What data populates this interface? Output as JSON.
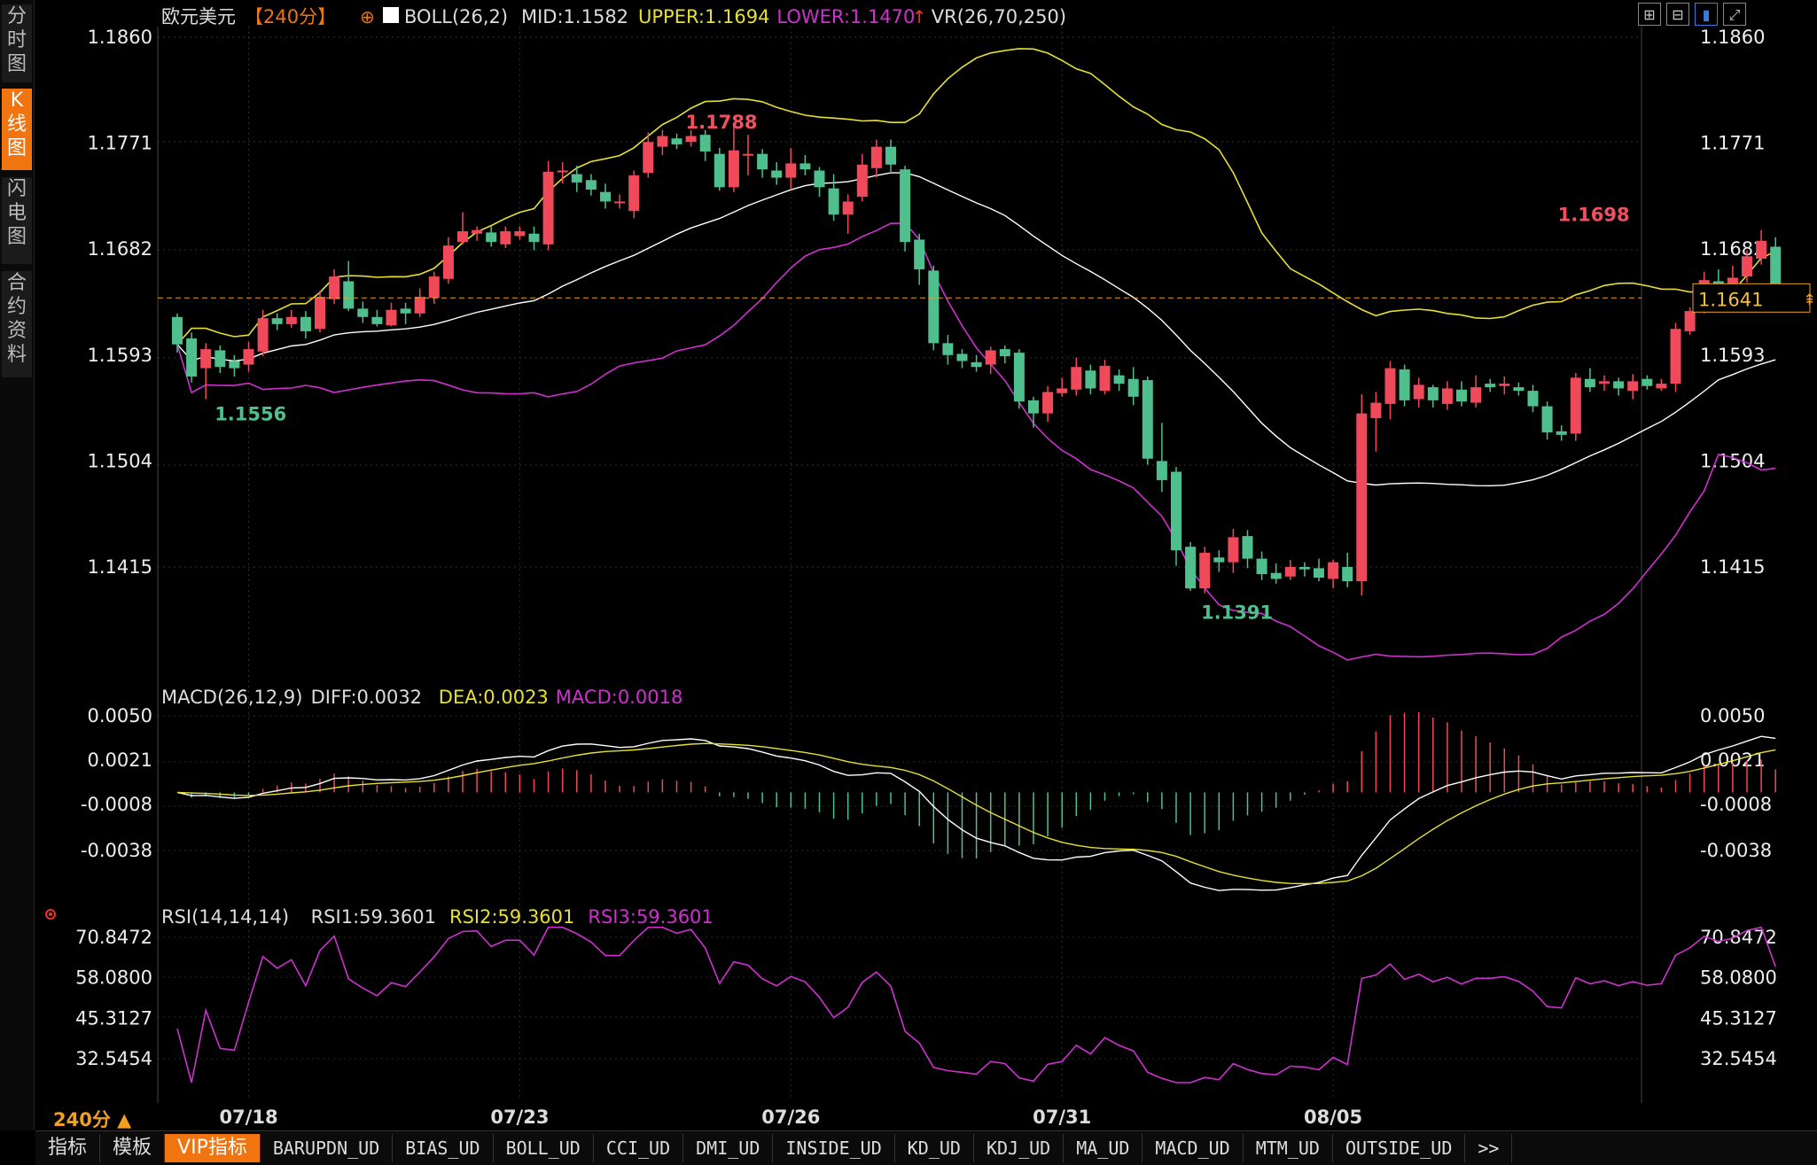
{
  "sidebar": {
    "tabs": [
      "分时图",
      "K线图",
      "闪电图",
      "合约资料"
    ],
    "active": 1
  },
  "toolbar_icons": [
    "layout-icon",
    "grid-icon",
    "chart-icon",
    "expand-icon"
  ],
  "header": {
    "symbol": "欧元美元",
    "period_tag": "【240分】",
    "boll": "BOLL(26,2)",
    "mid": "MID:1.1582",
    "upper": "UPPER:1.1694",
    "lower": "LOWER:1.1470",
    "vr": "VR(26,70,250)"
  },
  "macd_header": {
    "name": "MACD(26,12,9)",
    "diff": "DIFF:0.0032",
    "dea": "DEA:0.0023",
    "macd": "MACD:0.0018"
  },
  "rsi_header": {
    "name": "RSI(14,14,14)",
    "rsi1": "RSI1:59.3601",
    "rsi2": "RSI2:59.3601",
    "rsi3": "RSI3:59.3601"
  },
  "period_label": "240分 ▲",
  "bottom_tabs": [
    "指标",
    "模板",
    "VIP指标",
    "BARUPDN_UD",
    "BIAS_UD",
    "BOLL_UD",
    "CCI_UD",
    "DMI_UD",
    "INSIDE_UD",
    "KD_UD",
    "KDJ_UD",
    "MA_UD",
    "MACD_UD",
    "MTM_UD",
    "OUTSIDE_UD",
    ">>"
  ],
  "bottom_active": 2,
  "colors": {
    "up": "#f04a5a",
    "down": "#4fc08d",
    "upper": "#e8e030",
    "mid": "#ffffff",
    "lower": "#d030d0",
    "accent": "#f0740f",
    "label_high": "#f05060",
    "label_low": "#4fc08d"
  },
  "chart_data": {
    "type": "candlestick",
    "price_axis": {
      "ticks": [
        1.186,
        1.1771,
        1.1682,
        1.1593,
        1.1504,
        1.1415
      ],
      "range": [
        1.1325,
        1.1885
      ],
      "last_price": 1.1641
    },
    "dates": [
      "07/18",
      "07/23",
      "07/26",
      "07/31",
      "08/05"
    ],
    "date_index": [
      5,
      24,
      43,
      62,
      81
    ],
    "annotations": {
      "high": {
        "value": "1.1788",
        "index": 35
      },
      "low": {
        "value": "1.1391",
        "index": 71
      },
      "local_low": {
        "value": "1.1556",
        "index": 2
      },
      "local_high": {
        "value": "1.1698",
        "index": 96
      }
    },
    "candles": [
      [
        1.1625,
        1.1602,
        1.1628,
        1.1595
      ],
      [
        1.1607,
        1.1575,
        1.1612,
        1.157
      ],
      [
        1.1582,
        1.1598,
        1.1603,
        1.1556
      ],
      [
        1.1597,
        1.1583,
        1.1601,
        1.1578
      ],
      [
        1.1588,
        1.1582,
        1.1593,
        1.1575
      ],
      [
        1.1585,
        1.1598,
        1.1604,
        1.1579
      ],
      [
        1.1596,
        1.1624,
        1.1631,
        1.1592
      ],
      [
        1.1624,
        1.1619,
        1.1628,
        1.1614
      ],
      [
        1.1619,
        1.1625,
        1.1631,
        1.1616
      ],
      [
        1.1625,
        1.1613,
        1.163,
        1.1607
      ],
      [
        1.1615,
        1.1642,
        1.1647,
        1.1612
      ],
      [
        1.164,
        1.1659,
        1.1665,
        1.1636
      ],
      [
        1.1655,
        1.1632,
        1.1672,
        1.163
      ],
      [
        1.1632,
        1.1625,
        1.1638,
        1.162
      ],
      [
        1.1625,
        1.1619,
        1.1631,
        1.1617
      ],
      [
        1.1618,
        1.1631,
        1.1637,
        1.1617
      ],
      [
        1.1632,
        1.1628,
        1.1637,
        1.1619
      ],
      [
        1.1628,
        1.1642,
        1.1649,
        1.1625
      ],
      [
        1.1641,
        1.1659,
        1.1663,
        1.1636
      ],
      [
        1.1657,
        1.1685,
        1.1692,
        1.1653
      ],
      [
        1.1688,
        1.1697,
        1.1713,
        1.1686
      ],
      [
        1.1695,
        1.1698,
        1.1701,
        1.1689
      ],
      [
        1.1696,
        1.1688,
        1.1701,
        1.1684
      ],
      [
        1.1686,
        1.1697,
        1.1701,
        1.1683
      ],
      [
        1.1693,
        1.1697,
        1.1701,
        1.169
      ],
      [
        1.1695,
        1.1688,
        1.1701,
        1.1681
      ],
      [
        1.1686,
        1.1747,
        1.1756,
        1.1681
      ],
      [
        1.1748,
        1.1748,
        1.1755,
        1.1737
      ],
      [
        1.1745,
        1.1738,
        1.1752,
        1.173
      ],
      [
        1.174,
        1.1732,
        1.1745,
        1.1727
      ],
      [
        1.173,
        1.1722,
        1.1737,
        1.1716
      ],
      [
        1.1722,
        1.1722,
        1.1728,
        1.1716
      ],
      [
        1.1714,
        1.1744,
        1.1748,
        1.1708
      ],
      [
        1.1746,
        1.1772,
        1.178,
        1.1742
      ],
      [
        1.1768,
        1.1777,
        1.1782,
        1.1761
      ],
      [
        1.1775,
        1.177,
        1.1779,
        1.1766
      ],
      [
        1.1772,
        1.1777,
        1.1782,
        1.1768
      ],
      [
        1.1778,
        1.1764,
        1.1782,
        1.1756
      ],
      [
        1.1762,
        1.1734,
        1.1767,
        1.1731
      ],
      [
        1.1734,
        1.1765,
        1.1788,
        1.173
      ],
      [
        1.1762,
        1.1762,
        1.1778,
        1.1744
      ],
      [
        1.1762,
        1.1749,
        1.1766,
        1.1742
      ],
      [
        1.1748,
        1.1742,
        1.1755,
        1.1736
      ],
      [
        1.1742,
        1.1754,
        1.1767,
        1.1732
      ],
      [
        1.1754,
        1.1749,
        1.1761,
        1.1744
      ],
      [
        1.1748,
        1.1734,
        1.1751,
        1.1726
      ],
      [
        1.1733,
        1.1711,
        1.1745,
        1.1706
      ],
      [
        1.1711,
        1.1722,
        1.1728,
        1.1695
      ],
      [
        1.1726,
        1.1753,
        1.1762,
        1.1722
      ],
      [
        1.175,
        1.1768,
        1.1774,
        1.1742
      ],
      [
        1.1768,
        1.1753,
        1.1774,
        1.1747
      ],
      [
        1.1749,
        1.1688,
        1.1752,
        1.168
      ],
      [
        1.169,
        1.1665,
        1.1695,
        1.1652
      ],
      [
        1.1664,
        1.1603,
        1.1668,
        1.1597
      ],
      [
        1.1603,
        1.1593,
        1.161,
        1.1585
      ],
      [
        1.1594,
        1.1588,
        1.1598,
        1.1582
      ],
      [
        1.1587,
        1.1583,
        1.1593,
        1.1579
      ],
      [
        1.1585,
        1.1597,
        1.16,
        1.1577
      ],
      [
        1.1598,
        1.1592,
        1.1601,
        1.1586
      ],
      [
        1.1595,
        1.1554,
        1.1598,
        1.1548
      ],
      [
        1.1555,
        1.1544,
        1.1558,
        1.1532
      ],
      [
        1.1544,
        1.1562,
        1.1567,
        1.1537
      ],
      [
        1.1561,
        1.1565,
        1.1574,
        1.1558
      ],
      [
        1.1564,
        1.1583,
        1.1591,
        1.1559
      ],
      [
        1.158,
        1.1565,
        1.1585,
        1.156
      ],
      [
        1.1563,
        1.1584,
        1.1589,
        1.156
      ],
      [
        1.1576,
        1.1569,
        1.1581,
        1.1563
      ],
      [
        1.1573,
        1.1558,
        1.1583,
        1.1551
      ],
      [
        1.1572,
        1.1506,
        1.1575,
        1.1501
      ],
      [
        1.1504,
        1.1488,
        1.1536,
        1.1478
      ],
      [
        1.1495,
        1.1429,
        1.1499,
        1.1416
      ],
      [
        1.1432,
        1.1397,
        1.1436,
        1.1395
      ],
      [
        1.1397,
        1.1427,
        1.1432,
        1.1393
      ],
      [
        1.1423,
        1.1419,
        1.1429,
        1.1411
      ],
      [
        1.1419,
        1.144,
        1.1447,
        1.141
      ],
      [
        1.1441,
        1.1422,
        1.1446,
        1.1414
      ],
      [
        1.1422,
        1.1409,
        1.1428,
        1.1404
      ],
      [
        1.141,
        1.1405,
        1.1418,
        1.1401
      ],
      [
        1.1407,
        1.1415,
        1.1421,
        1.1404
      ],
      [
        1.1415,
        1.1413,
        1.1419,
        1.1407
      ],
      [
        1.1414,
        1.1406,
        1.1422,
        1.1403
      ],
      [
        1.1405,
        1.1419,
        1.1421,
        1.1397
      ],
      [
        1.1415,
        1.1403,
        1.1427,
        1.1398
      ],
      [
        1.1403,
        1.1544,
        1.156,
        1.1391
      ],
      [
        1.154,
        1.1553,
        1.1562,
        1.1512
      ],
      [
        1.1552,
        1.1582,
        1.1588,
        1.1539
      ],
      [
        1.1581,
        1.1555,
        1.1585,
        1.155
      ],
      [
        1.1556,
        1.1568,
        1.1574,
        1.1549
      ],
      [
        1.1566,
        1.1555,
        1.1568,
        1.1549
      ],
      [
        1.1552,
        1.1565,
        1.1571,
        1.1547
      ],
      [
        1.1564,
        1.1554,
        1.1571,
        1.155
      ],
      [
        1.1553,
        1.1566,
        1.1576,
        1.1549
      ],
      [
        1.1569,
        1.1566,
        1.1573,
        1.1562
      ],
      [
        1.1567,
        1.1569,
        1.1575,
        1.156
      ],
      [
        1.1566,
        1.1563,
        1.157,
        1.1559
      ],
      [
        1.1563,
        1.155,
        1.1568,
        1.1545
      ],
      [
        1.155,
        1.1528,
        1.1554,
        1.1522
      ],
      [
        1.1529,
        1.1526,
        1.1534,
        1.1521
      ],
      [
        1.1527,
        1.1574,
        1.1578,
        1.1521
      ],
      [
        1.1573,
        1.1566,
        1.1582,
        1.1562
      ],
      [
        1.1569,
        1.1571,
        1.1576,
        1.1563
      ],
      [
        1.1571,
        1.1565,
        1.1574,
        1.1559
      ],
      [
        1.1563,
        1.1571,
        1.1577,
        1.1556
      ],
      [
        1.1573,
        1.1567,
        1.1576,
        1.1564
      ],
      [
        1.1565,
        1.1569,
        1.1573,
        1.1563
      ],
      [
        1.1569,
        1.1615,
        1.162,
        1.1562
      ],
      [
        1.1613,
        1.163,
        1.1633,
        1.161
      ],
      [
        1.1632,
        1.1656,
        1.1663,
        1.1628
      ],
      [
        1.1655,
        1.1651,
        1.1665,
        1.1645
      ],
      [
        1.1652,
        1.1658,
        1.1668,
        1.1648
      ],
      [
        1.1659,
        1.1676,
        1.1681,
        1.1654
      ],
      [
        1.1674,
        1.1689,
        1.1698,
        1.1669
      ],
      [
        1.1684,
        1.1647,
        1.1692,
        1.1635
      ]
    ],
    "macd": {
      "axis_ticks": [
        0.005,
        0.0021,
        -0.0008,
        -0.0038
      ],
      "range": [
        -0.0075,
        0.0065
      ]
    },
    "rsi": {
      "axis_ticks": [
        70.8472,
        58.08,
        45.3127,
        32.5454
      ],
      "range": [
        23.5,
        75
      ]
    }
  }
}
